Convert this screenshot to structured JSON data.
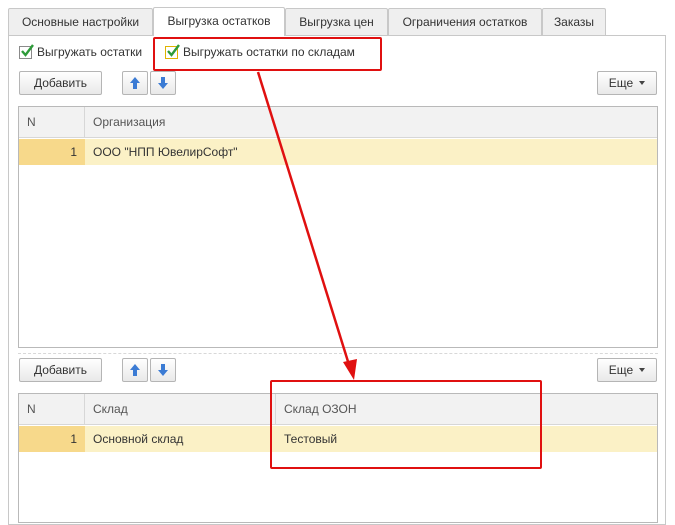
{
  "tabs": [
    {
      "label": "Основные настройки",
      "active": false
    },
    {
      "label": "Выгрузка остатков",
      "active": true
    },
    {
      "label": "Выгрузка цен",
      "active": false
    },
    {
      "label": "Ограничения остатков",
      "active": false
    },
    {
      "label": "Заказы",
      "active": false
    }
  ],
  "options": {
    "export_stock": {
      "label": "Выгружать остатки",
      "checked": true
    },
    "export_stock_by_warehouse": {
      "label": "Выгружать остатки по складам",
      "checked": true
    }
  },
  "toolbar_top": {
    "add_label": "Добавить",
    "more_label": "Еще"
  },
  "org_table": {
    "columns": [
      "N",
      "Организация"
    ],
    "rows": [
      {
        "n": "1",
        "organization": "ООО \"НПП ЮвелирСофт\""
      }
    ]
  },
  "toolbar_bottom": {
    "add_label": "Добавить",
    "more_label": "Еще"
  },
  "warehouse_table": {
    "columns": [
      "N",
      "Склад",
      "Склад ОЗОН"
    ],
    "rows": [
      {
        "n": "1",
        "warehouse": "Основной склад",
        "ozon_warehouse": "Тестовый"
      }
    ]
  },
  "colors": {
    "accent_red": "#e01010",
    "selected_row": "#fbf1c6",
    "selected_num": "#f7d98b",
    "check_green": "#2e9b3a"
  },
  "icons": [
    "check-icon",
    "arrow-up-icon",
    "arrow-down-icon",
    "caret-down-icon"
  ]
}
